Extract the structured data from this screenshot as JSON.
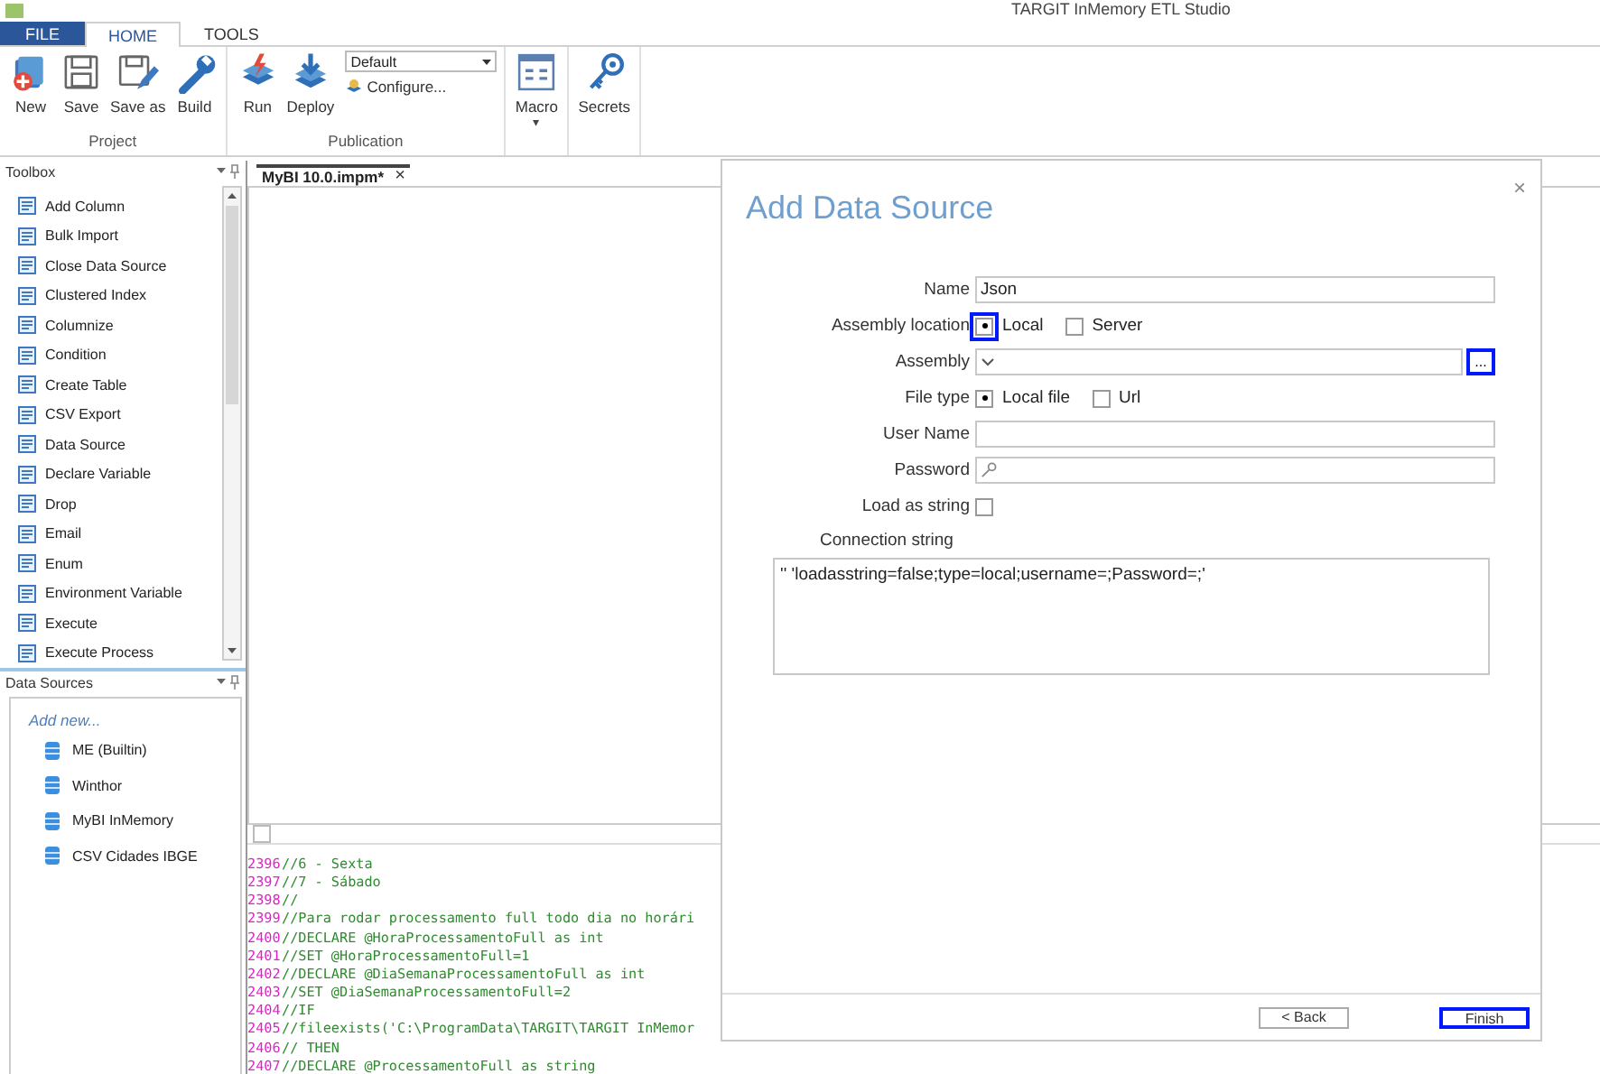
{
  "window": {
    "title": "TARGIT InMemory ETL Studio"
  },
  "ribbon": {
    "tabs": [
      {
        "label": "FILE",
        "kind": "file",
        "selected": false
      },
      {
        "label": "HOME",
        "kind": "tab",
        "selected": true
      },
      {
        "label": "TOOLS",
        "kind": "tab",
        "selected": false
      }
    ],
    "groups": [
      {
        "label": "Project",
        "buttons": [
          {
            "label": "New",
            "kind": "new"
          },
          {
            "label": "Save",
            "kind": "save"
          },
          {
            "label": "Save as",
            "kind": "saveas"
          },
          {
            "label": "Build",
            "kind": "build"
          }
        ]
      },
      {
        "label": "Publication",
        "buttons": [
          {
            "label": "Run",
            "kind": "run"
          },
          {
            "label": "Deploy",
            "kind": "deploy"
          }
        ],
        "dropdown": "Default",
        "link": "Configure..."
      },
      {
        "buttons": [
          {
            "label": "Macro",
            "kind": "macro",
            "caret": "▾"
          }
        ]
      },
      {
        "buttons": [
          {
            "label": "Secrets",
            "kind": "secrets"
          }
        ]
      }
    ]
  },
  "toolbox": {
    "title": "Toolbox",
    "items": [
      "Add Column",
      "Bulk Import",
      "Close Data Source",
      "Clustered Index",
      "Columnize",
      "Condition",
      "Create Table",
      "CSV Export",
      "Data Source",
      "Declare Variable",
      "Drop",
      "Email",
      "Enum",
      "Environment Variable",
      "Execute",
      "Execute Process"
    ]
  },
  "data_sources": {
    "title": "Data Sources",
    "add_new": "Add new...",
    "items": [
      "ME (Builtin)",
      "Winthor",
      "MyBI InMemory",
      "CSV Cidades IBGE"
    ]
  },
  "editor": {
    "tab": {
      "label": "MyBI 10.0.impm*",
      "close": "×"
    },
    "lines": [
      {
        "number": "2396",
        "text": "//6 - Sexta"
      },
      {
        "number": "2397",
        "text": "//7 - Sábado"
      },
      {
        "number": "2398",
        "text": "//"
      },
      {
        "number": "2399",
        "text": "//Para rodar processamento full todo dia no horári"
      },
      {
        "number": "2400",
        "text": "//DECLARE @HoraProcessamentoFull as int"
      },
      {
        "number": "2401",
        "text": "//SET @HoraProcessamentoFull=1"
      },
      {
        "number": "2402",
        "text": "//DECLARE @DiaSemanaProcessamentoFull as int"
      },
      {
        "number": "2403",
        "text": "//SET @DiaSemanaProcessamentoFull=2"
      },
      {
        "number": "2404",
        "text": "//IF"
      },
      {
        "number": "2405",
        "text": "//fileexists('C:\\ProgramData\\TARGIT\\TARGIT InMemor"
      },
      {
        "number": "2406",
        "text": "// THEN"
      },
      {
        "number": "2407",
        "text": "//DECLARE @ProcessamentoFull as string"
      }
    ]
  },
  "dialog": {
    "title": "Add Data Source",
    "close": "×",
    "fields": [
      {
        "label": "Name",
        "kind": "text",
        "value": "Json"
      },
      {
        "label": "Assembly location",
        "kind": "radio",
        "focused": true,
        "options": [
          {
            "label": "Local",
            "selected": true
          },
          {
            "label": "Server",
            "selected": false
          }
        ]
      },
      {
        "label": "Assembly",
        "kind": "select",
        "button": "...",
        "focused": true
      },
      {
        "label": "File type",
        "kind": "radio",
        "focused": false,
        "options": [
          {
            "label": "Local file",
            "selected": true
          },
          {
            "label": "Url",
            "selected": false
          }
        ]
      },
      {
        "label": "User Name",
        "kind": "text"
      },
      {
        "label": "Password",
        "kind": "password"
      },
      {
        "label": "Load as string",
        "kind": "checkbox",
        "checked": false
      }
    ],
    "connection_label": "Connection string",
    "connection_value": "'' 'loadasstring=false;type=local;username=;Password=;'",
    "buttons": [
      {
        "label": "< Back",
        "focused": false
      },
      {
        "label": "Finish",
        "focused": true
      }
    ]
  }
}
